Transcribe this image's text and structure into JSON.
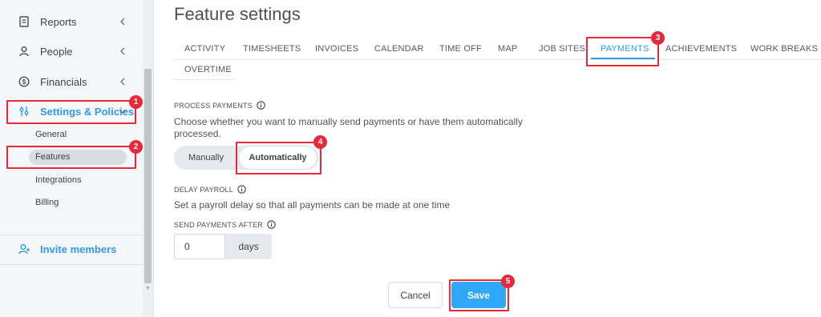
{
  "sidebar": {
    "items": [
      {
        "label": "Reports",
        "icon": "document-icon"
      },
      {
        "label": "People",
        "icon": "person-icon"
      },
      {
        "label": "Financials",
        "icon": "dollar-circle-icon"
      },
      {
        "label": "Settings & Policies",
        "icon": "sliders-icon"
      }
    ],
    "sub_items": [
      {
        "label": "General"
      },
      {
        "label": "Features"
      },
      {
        "label": "Integrations"
      },
      {
        "label": "Billing"
      }
    ],
    "invite_label": "Invite members"
  },
  "page_title": "Feature settings",
  "tabs": [
    {
      "label": "ACTIVITY"
    },
    {
      "label": "TIMESHEETS"
    },
    {
      "label": "INVOICES"
    },
    {
      "label": "CALENDAR"
    },
    {
      "label": "TIME OFF"
    },
    {
      "label": "MAP"
    },
    {
      "label": "JOB SITES"
    },
    {
      "label": "PAYMENTS"
    },
    {
      "label": "ACHIEVEMENTS"
    },
    {
      "label": "WORK BREAKS"
    },
    {
      "label": "OVERTIME"
    }
  ],
  "process_payments": {
    "label": "PROCESS PAYMENTS",
    "description_line1": "Choose whether you want to manually send payments or have them automatically",
    "description_line2": "processed.",
    "option_manual": "Manually",
    "option_auto": "Automatically",
    "selected": "Automatically"
  },
  "delay_payroll": {
    "label": "DELAY PAYROLL",
    "description": "Set a payroll delay so that all payments can be made at one time"
  },
  "send_after": {
    "label": "SEND PAYMENTS AFTER",
    "value": "0",
    "unit": "days"
  },
  "actions": {
    "cancel_label": "Cancel",
    "save_label": "Save"
  },
  "badges": [
    "1",
    "2",
    "3",
    "4",
    "5"
  ],
  "colors": {
    "accent": "#2f9bee",
    "save_button": "#2fa8f7",
    "highlight": "#e8283b"
  }
}
